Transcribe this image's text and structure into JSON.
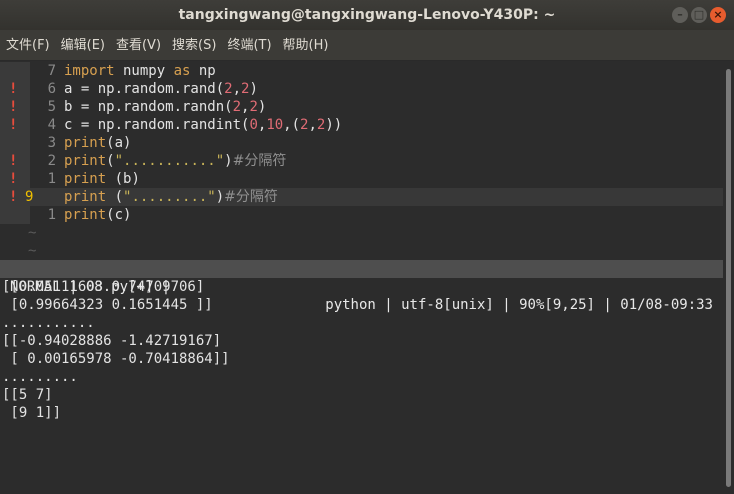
{
  "window": {
    "title": "tangxingwang@tangxingwang-Lenovo-Y430P: ~",
    "controls": [
      "–",
      "□",
      "×"
    ]
  },
  "menu": [
    "文件(F)",
    "编辑(E)",
    "查看(V)",
    "搜索(S)",
    "终端(T)",
    "帮助(H)"
  ],
  "editor": {
    "lines": [
      {
        "mark": "",
        "num": "7",
        "tokens": [
          [
            "kw",
            "import"
          ],
          [
            "",
            "numpy"
          ],
          [
            "kw",
            "as"
          ],
          [
            "",
            "np"
          ]
        ],
        "sep": " "
      },
      {
        "mark": "!",
        "num": "6",
        "code": "a = np.random.rand(2,2)"
      },
      {
        "mark": "!",
        "num": "5",
        "code": "b = np.random.randn(2,2)"
      },
      {
        "mark": "!",
        "num": "4",
        "code": "c = np.random.randint(0,10,(2,2))"
      },
      {
        "mark": "",
        "num": "3",
        "code": "print(a)"
      },
      {
        "mark": "!",
        "num": "2",
        "code": "print(\"...........\")#分隔符"
      },
      {
        "mark": "!",
        "num": "1",
        "code": "print (b)"
      },
      {
        "mark": "!",
        "num": "9",
        "code": "print (\".........\")#分隔符",
        "current": true
      },
      {
        "mark": "",
        "num": "1",
        "code": "print(c)"
      }
    ],
    "tildes": [
      "~",
      "~"
    ]
  },
  "statusline": {
    "left": "NORMAL | 08.py[+] |",
    "right": "python | utf-8[unix] | 90%[9,25] | 01/08-09:33"
  },
  "output": [
    "[[0.05111603 0.74709706]",
    " [0.99664323 0.1651445 ]]",
    "...........",
    "[[-0.94028886 -1.42719167]",
    " [ 0.00165978 -0.70418864]]",
    ".........",
    "[[5 7]",
    " [9 1]]"
  ]
}
